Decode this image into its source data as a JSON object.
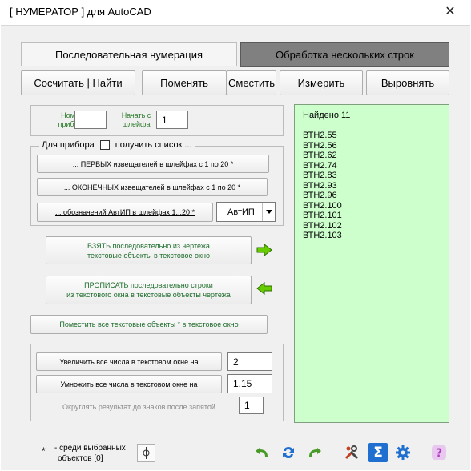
{
  "window": {
    "title": "[ НУМЕРАТОР ]  для AutoCAD",
    "close_glyph": "✕"
  },
  "tabs": [
    {
      "label": "Последовательная нумерация"
    },
    {
      "label": "Обработка  нескольких  строк"
    }
  ],
  "toolbar": [
    {
      "label": "Сосчитать | Найти"
    },
    {
      "label": "Поменять"
    },
    {
      "label": "Сместить"
    },
    {
      "label": "Измерить"
    },
    {
      "label": "Выровнять"
    }
  ],
  "device": {
    "number_label": "Номер прибора",
    "number_value": "",
    "start_label": "Начать с шлейфа",
    "start_value": "1"
  },
  "list_group": {
    "title_prefix": "Для прибора",
    "title_suffix": "получить список ...",
    "first_button": "... ПЕРВЫХ извещателей в шлейфах  с 1 по 20  *",
    "last_button": "... ОКОНЕЧНЫХ извещателей  в шлейфах  с 1 по 20  *",
    "designations_button": "... обозначений АвтИП в шлейфах 1...20  *",
    "designation_select": "АвтИП"
  },
  "transfer": {
    "take_button_line1": "ВЗЯТЬ последовательно из чертежа",
    "take_button_line2": "текстовые объекты в текстовое окно",
    "write_button_line1": "ПРОПИСАТЬ последовательно строки",
    "write_button_line2": "из текстового окна  в текстовые объекты чертежа",
    "place_all_button": "Поместить все текстовые объекты  *  в текстовое окно"
  },
  "math": {
    "increase_label": "Увеличить все числа в текстовом окне на",
    "increase_value": "2",
    "multiply_label": "Умножить все числа в текстовом окне на",
    "multiply_value": "1,15",
    "round_label": "Округлять результат до знаков после запятой",
    "round_value": "1"
  },
  "result": {
    "header": "Найдено 11",
    "items": [
      "ВТН2.55",
      "ВТН2.56",
      "ВТН2.62",
      "ВТН2.74",
      "ВТН2.83",
      "ВТН2.93",
      "ВТН2.96",
      "ВТН2.100",
      "ВТН2.101",
      "ВТН2.102",
      "ВТН2.103"
    ]
  },
  "footer": {
    "asterisk": "*",
    "selected_note_line1": "- среди выбранных",
    "selected_note_line2": "объектов  [0]",
    "icons": [
      "crosshair-icon",
      "undo-icon",
      "refresh-icon",
      "redo-icon",
      "tools-icon",
      "sigma-icon",
      "gear-icon",
      "help-icon"
    ]
  },
  "colors": {
    "green_text": "#2a7a2a",
    "result_bg": "#ccffcc",
    "active_tab": "#808080",
    "arrow_green": "#66cc00",
    "icon_blue": "#1e6fd0",
    "icon_green": "#4a9a2a",
    "icon_purple": "#b040c0"
  }
}
